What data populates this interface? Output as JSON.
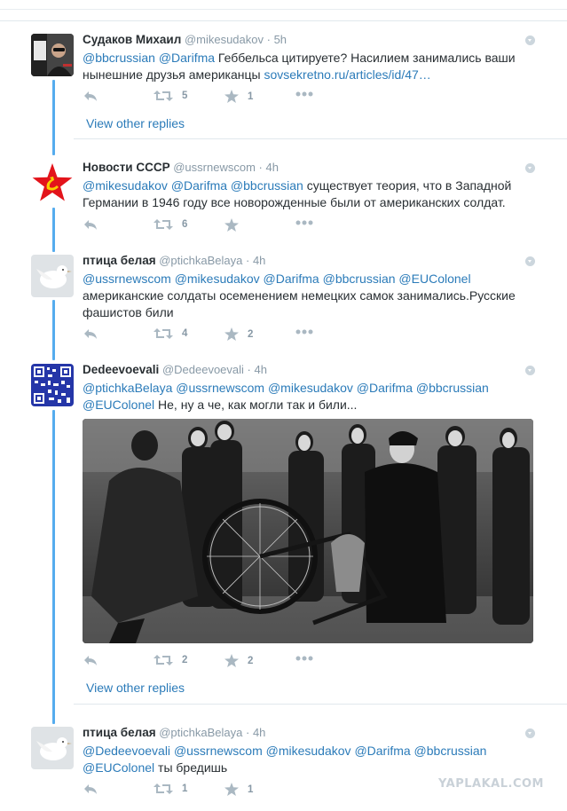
{
  "tweets": [
    {
      "fullname": "Судаков Михаил",
      "username": "@mikesudakov",
      "time": "· 5h",
      "mentions": [
        "@bbcrussian",
        "@Darifma"
      ],
      "text": "Геббельса цитируете? Насилием занимались ваши нынешние друзья американцы",
      "link": "sovsekretno.ru/articles/id/47…",
      "retweets": "5",
      "likes": "1"
    },
    {
      "fullname": "Новости СССР",
      "username": "@ussrnewscom",
      "time": "· 4h",
      "mentions": [
        "@mikesudakov",
        "@Darifma",
        "@bbcrussian"
      ],
      "text": "существует теория, что в Западной Германии в 1946 году все новорожденные были от американских солдат.",
      "retweets": "6",
      "likes": ""
    },
    {
      "fullname": "птица белая",
      "username": "@ptichkaBelaya",
      "time": "· 4h",
      "mentions": [
        "@ussrnewscom",
        "@mikesudakov",
        "@Darifma",
        "@bbcrussian",
        "@EUColonel"
      ],
      "text": "американские солдаты осеменением немецких самок занимались.Русские фашистов били",
      "retweets": "4",
      "likes": "2"
    },
    {
      "fullname": "Dedeevoevali",
      "username": "@Dedeevoevali",
      "time": "· 4h",
      "mentions": [
        "@ptichkaBelaya",
        "@ussrnewscom",
        "@mikesudakov",
        "@Darifma",
        "@bbcrussian",
        "@EUColonel"
      ],
      "text": "Не, ну а че, как могли так и били...",
      "retweets": "2",
      "likes": "2"
    },
    {
      "fullname": "птица белая",
      "username": "@ptichkaBelaya",
      "time": "· 4h",
      "mentions": [
        "@Dedeevoevali",
        "@ussrnewscom",
        "@mikesudakov",
        "@Darifma",
        "@bbcrussian",
        "@EUColonel"
      ],
      "text": "ты бредишь",
      "retweets": "1",
      "likes": "1"
    }
  ],
  "view_other_replies": "View other replies",
  "watermark": "YAPLAKAL.COM",
  "colors": {
    "link": "#2b7bb9",
    "thread": "#55acee",
    "muted": "#8899a6",
    "icon": "#aab8c2"
  }
}
